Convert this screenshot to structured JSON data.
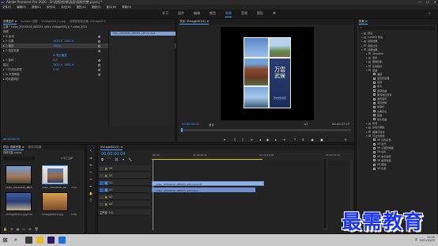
{
  "app": {
    "title": "Adobe Premiere Pro 2020 - D:\\视频\\剪辑\\画面\\视频完整.prproj *",
    "logo": "Pr"
  },
  "window_controls": [
    "—",
    "☐",
    "✕"
  ],
  "menu": [
    "文件(F)",
    "编辑(E)",
    "剪辑(C)",
    "序列(S)",
    "标记(M)",
    "图形(G)",
    "视图(V)",
    "窗口(W)",
    "帮助(H)"
  ],
  "workspaces": {
    "items": [
      "学习",
      "组件",
      "编辑",
      "颜色",
      "效果",
      "音频",
      "图形",
      "库"
    ],
    "active": "效果",
    "overflow": "»"
  },
  "effect_controls": {
    "tabs": [
      "效果控件 ≡",
      "Lumetri 范围",
      "Vintage001(1).jpg",
      "音频剪辑混合器: Vintage001"
    ],
    "source_row": "主要 * video_20210916_085034_edit ▸ Vintage001(1) * video_2021",
    "rows": [
      {
        "label": "视频",
        "v": "",
        "v2": "",
        "kf": false
      },
      {
        "label": "▾ fx 运动",
        "v": "",
        "v2": "",
        "kf": true
      },
      {
        "label": "   ▸ ⏱ 位置",
        "v": "1920.0",
        "v2": "1080.0",
        "kf": true
      },
      {
        "label": "   ▸ ⏱ 缩放",
        "v": "100.0",
        "v2": "",
        "kf": true,
        "sel": true
      },
      {
        "label": "   ▸ ⏱ 缩放宽度",
        "v": "",
        "v2": "",
        "kf": true
      },
      {
        "label": "",
        "v": "☑ 等比缩放",
        "v2": "",
        "kf": false
      },
      {
        "label": "   ▸ ⏱ 旋转",
        "v": "0.0",
        "v2": "",
        "kf": true
      },
      {
        "label": "     锚点",
        "v": "1920.0",
        "v2": "1080.0",
        "kf": true
      },
      {
        "label": "   ▸ ⏱ 防闪烁滤镜",
        "v": "0.00",
        "v2": "",
        "kf": true
      },
      {
        "label": "▸ fx 不透明度",
        "v": "",
        "v2": "",
        "kf": true
      },
      {
        "label": "▸ 时间重映射",
        "v": "",
        "v2": "",
        "kf": false
      }
    ],
    "timecode": "00:00:00:04",
    "mini_clip": "video_20210916_085034_edit (1).mp4"
  },
  "program": {
    "tab": "节目: Vintage001(1) ≡",
    "timecode_left": "00:00:00:04",
    "fit": "适合",
    "ratio": "1/2",
    "timecode_right": "00:00:07:15",
    "poster_text": "万雲武候",
    "poster_sub": "历史文化景区"
  },
  "project": {
    "tabs": [
      "项目: 视频完整 ≡",
      "媒体浏览器"
    ],
    "filename": "视频完整.prproj",
    "items_count": "2 项已选择",
    "items": [
      {
        "label": "video_20210916_08...",
        "dur": "7:15"
      },
      {
        "label": "video_20210916_08...",
        "dur": "7:15"
      },
      {
        "label": "Vintage001(1).jpg",
        "dur": "5:00"
      },
      {
        "label": "Vintage001(1).jpg",
        "dur": "5:00"
      }
    ]
  },
  "timeline": {
    "tab": "Vintage001(1) ≡",
    "timecode": "00:00:00:04",
    "ruler": [
      ":00:00",
      "00:00:05:00",
      "00:00:10:00",
      "00:00:15:00"
    ],
    "tracks": [
      {
        "name": "V3",
        "type": "video"
      },
      {
        "name": "V2",
        "type": "video"
      },
      {
        "name": "V1",
        "type": "video"
      },
      {
        "name": "A1",
        "type": "audio"
      },
      {
        "name": "A2",
        "type": "audio"
      },
      {
        "name": "A3",
        "type": "audio"
      },
      {
        "name": "主声道",
        "type": "master",
        "value": "0.0"
      }
    ],
    "clips": [
      {
        "label": "video_20210916_085034_edit.mp4 [V]",
        "track": "V1",
        "color": "#8fb0e6"
      },
      {
        "label": "video_20210916_085034_edit.mp4",
        "track": "A1",
        "color": "#6f8fd0"
      }
    ]
  },
  "effects": {
    "tab": "效果 ≡",
    "items": [
      {
        "label": "预设",
        "depth": 0,
        "arr": "▸",
        "fx": false
      },
      {
        "label": "Lumetri 预设",
        "depth": 0,
        "arr": "▸",
        "fx": false
      },
      {
        "label": "音频效果",
        "depth": 0,
        "arr": "▸",
        "fx": false
      },
      {
        "label": "音频过渡",
        "depth": 0,
        "arr": "▸",
        "fx": false
      },
      {
        "label": "视频效果",
        "depth": 0,
        "arr": "▾",
        "fx": false
      },
      {
        "label": "Obsolete",
        "depth": 1,
        "arr": "▸",
        "fx": false
      },
      {
        "label": "变换",
        "depth": 1,
        "arr": "▸",
        "fx": false
      },
      {
        "label": "图像控制",
        "depth": 1,
        "arr": "▸",
        "fx": false
      },
      {
        "label": "实用程序",
        "depth": 1,
        "arr": "▸",
        "fx": false
      },
      {
        "label": "扭曲",
        "depth": 1,
        "arr": "▾",
        "fx": false
      },
      {
        "label": "偏移",
        "depth": 2,
        "arr": "",
        "fx": true
      },
      {
        "label": "变形稳定器",
        "depth": 2,
        "arr": "",
        "fx": true
      },
      {
        "label": "变换",
        "depth": 2,
        "arr": "",
        "fx": true
      },
      {
        "label": "放大",
        "depth": 2,
        "arr": "",
        "fx": true
      },
      {
        "label": "旋转扭曲",
        "depth": 2,
        "arr": "",
        "fx": true
      },
      {
        "label": "果冻效应修复",
        "depth": 2,
        "arr": "",
        "fx": true
      },
      {
        "label": "波形变形",
        "depth": 2,
        "arr": "",
        "fx": true
      },
      {
        "label": "湍流置换",
        "depth": 2,
        "arr": "",
        "fx": true
      },
      {
        "label": "球面化",
        "depth": 2,
        "arr": "",
        "fx": true
      },
      {
        "label": "边角定位",
        "depth": 2,
        "arr": "",
        "fx": true
      },
      {
        "label": "镜像",
        "depth": 2,
        "arr": "",
        "fx": true
      },
      {
        "label": "镜头扭曲",
        "depth": 2,
        "arr": "",
        "fx": true
      },
      {
        "label": "时间",
        "depth": 1,
        "arr": "▸",
        "fx": false
      },
      {
        "label": "杂色与颗粒",
        "depth": 1,
        "arr": "▸",
        "fx": false
      },
      {
        "label": "模糊与锐化",
        "depth": 1,
        "arr": "▸",
        "fx": false
      },
      {
        "label": "沉浸式视频",
        "depth": 1,
        "arr": "▾",
        "fx": false
      },
      {
        "label": "VR 分形杂色",
        "depth": 2,
        "arr": "",
        "fx": true
      },
      {
        "label": "VR 发光",
        "depth": 2,
        "arr": "",
        "fx": true
      },
      {
        "label": "VR 平面到球面",
        "depth": 2,
        "arr": "",
        "fx": true
      },
      {
        "label": "VR 投影",
        "depth": 2,
        "arr": "",
        "fx": true
      },
      {
        "label": "VR 数字故障",
        "depth": 2,
        "arr": "",
        "fx": true
      },
      {
        "label": "VR 旋转球面",
        "depth": 2,
        "arr": "",
        "fx": true
      },
      {
        "label": "VR 模糊",
        "depth": 2,
        "arr": "",
        "fx": true
      },
      {
        "label": "VR 色差",
        "depth": 2,
        "arr": "",
        "fx": true
      }
    ]
  },
  "watermark": "最需教育",
  "taskbar": {
    "time": "11:05",
    "date": "2021/10/15",
    "lang": "中"
  }
}
